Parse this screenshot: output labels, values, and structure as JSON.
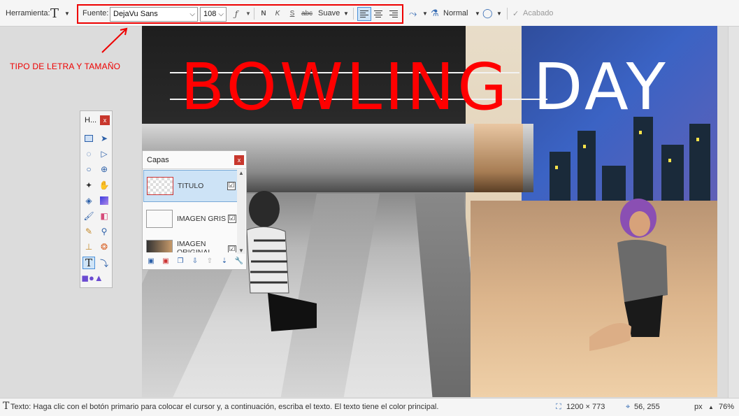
{
  "toolbar": {
    "tool_label": "Herramienta:",
    "tool_icon": "text-tool-icon",
    "font_label": "Fuente:",
    "font_value": "DejaVu Sans",
    "size_value": "108",
    "bold": "N",
    "italic": "K",
    "underline": "S",
    "strike": "abc",
    "antialias_value": "Suave",
    "blend_value": "Normal",
    "finish_label": "Acabado"
  },
  "annotation": {
    "text": "TIPO DE LETRA Y TAMAÑO",
    "color": "#ff0000"
  },
  "canvas": {
    "title_red": "BOWLING",
    "title_white": "DAY",
    "title_color_red": "#ff0000",
    "title_color_white": "#ffffff"
  },
  "tools_panel": {
    "title": "H...",
    "close": "x"
  },
  "layers_panel": {
    "title": "Capas",
    "close": "x",
    "layers": [
      {
        "name": "TITULO",
        "checked": "☑"
      },
      {
        "name": "IMAGEN GRIS",
        "checked": "☑"
      },
      {
        "name": "IMAGEN ORIGINAL",
        "checked": "☑"
      }
    ]
  },
  "status": {
    "hint": "Texto: Haga clic con el botón primario para colocar el cursor y, a continuación, escriba el texto. El texto tiene el color principal.",
    "image_size": "1200 × 773",
    "cursor_pos": "56, 255",
    "unit": "px",
    "zoom": "76%"
  }
}
